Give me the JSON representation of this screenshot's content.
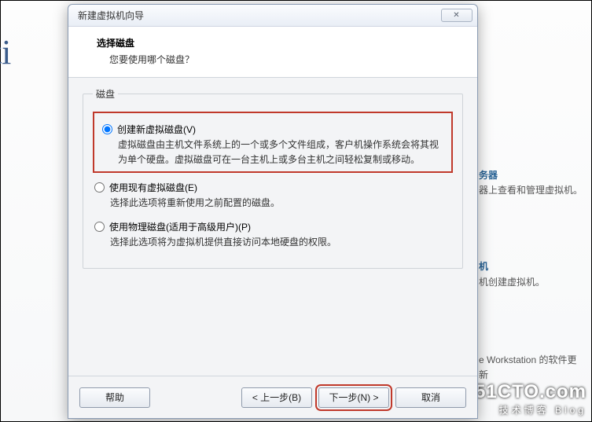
{
  "backdrop": {
    "brand_fragment": "stati",
    "side": {
      "link1": "务器",
      "desc1": "器上查看和管理虚拟机。",
      "link2": "机",
      "desc2": "机创建虚拟机。",
      "footer": "e Workstation 的软件更新"
    },
    "watermark": {
      "main": "51CTO.com",
      "sub": "技术博客   Blog"
    }
  },
  "dialog": {
    "title": "新建虚拟机向导",
    "header_title": "选择磁盘",
    "header_sub": "您要使用哪个磁盘？",
    "group_legend": "磁盘",
    "options": [
      {
        "label": "创建新虚拟磁盘(V)",
        "desc": "虚拟磁盘由主机文件系统上的一个或多个文件组成，客户机操作系统会将其视为单个硬盘。虚拟磁盘可在一台主机上或多台主机之间轻松复制或移动。",
        "checked": true
      },
      {
        "label": "使用现有虚拟磁盘(E)",
        "desc": "选择此选项将重新使用之前配置的磁盘。",
        "checked": false
      },
      {
        "label": "使用物理磁盘(适用于高级用户)(P)",
        "desc": "选择此选项将为虚拟机提供直接访问本地硬盘的权限。",
        "checked": false
      }
    ],
    "buttons": {
      "help": "帮助",
      "back": "< 上一步(B)",
      "next": "下一步(N) >",
      "cancel": "取消"
    }
  }
}
